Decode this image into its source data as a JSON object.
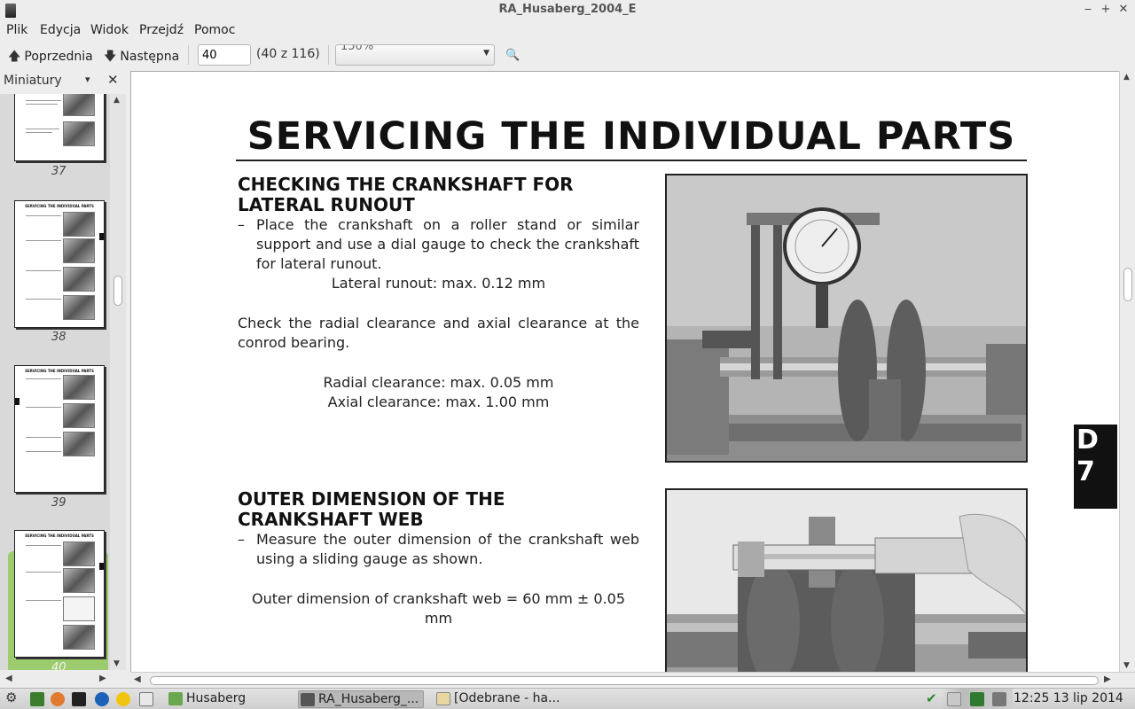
{
  "window": {
    "title": "RA_Husaberg_2004_E"
  },
  "menu": [
    "Plik",
    "Edycja",
    "Widok",
    "Przejdź",
    "Pomoc"
  ],
  "toolbar": {
    "prev_label": "Poprzednia",
    "next_label": "Następna",
    "page_value": "40",
    "page_count": "(40 z 116)",
    "zoom_value": "150%"
  },
  "sidebar": {
    "title": "Miniatury",
    "thumbnails": [
      {
        "label": "37"
      },
      {
        "label": "38",
        "title": "SERVICING THE INDIVIDUAL PARTS"
      },
      {
        "label": "39",
        "title": "SERVICING THE INDIVIDUAL PARTS"
      },
      {
        "label": "40",
        "title": "SERVICING THE INDIVIDUAL PARTS"
      }
    ]
  },
  "document": {
    "title": "SERVICING THE INDIVIDUAL PARTS",
    "section1": {
      "heading": "CHECKING THE CRANKSHAFT FOR LATERAL RUNOUT",
      "bullet": "Place the crankshaft on a roller stand or similar support and use a dial gauge to check the crankshaft for lateral runout.",
      "spec": "Lateral runout: max. 0.12 mm",
      "para": "Check the radial clearance and axial clearance at the conrod bearing.",
      "spec2": "Radial clearance: max. 0.05 mm",
      "spec3": "Axial clearance: max. 1.00 mm"
    },
    "section2": {
      "heading": "OUTER DIMENSION OF THE CRANKSHAFT WEB",
      "bullet": "Measure the outer dimension of the crankshaft web using a sliding gauge as shown.",
      "spec": "Outer dimension of crankshaft web = 60 mm ± 0.05 mm"
    },
    "tab_text_1": "D",
    "tab_text_2": "7"
  },
  "taskbar": {
    "tasks": [
      {
        "label": "Husaberg"
      },
      {
        "label": "RA_Husaberg_..."
      },
      {
        "label": "[Odebrane - ha..."
      }
    ],
    "clock": "12:25  13 lip 2014"
  }
}
